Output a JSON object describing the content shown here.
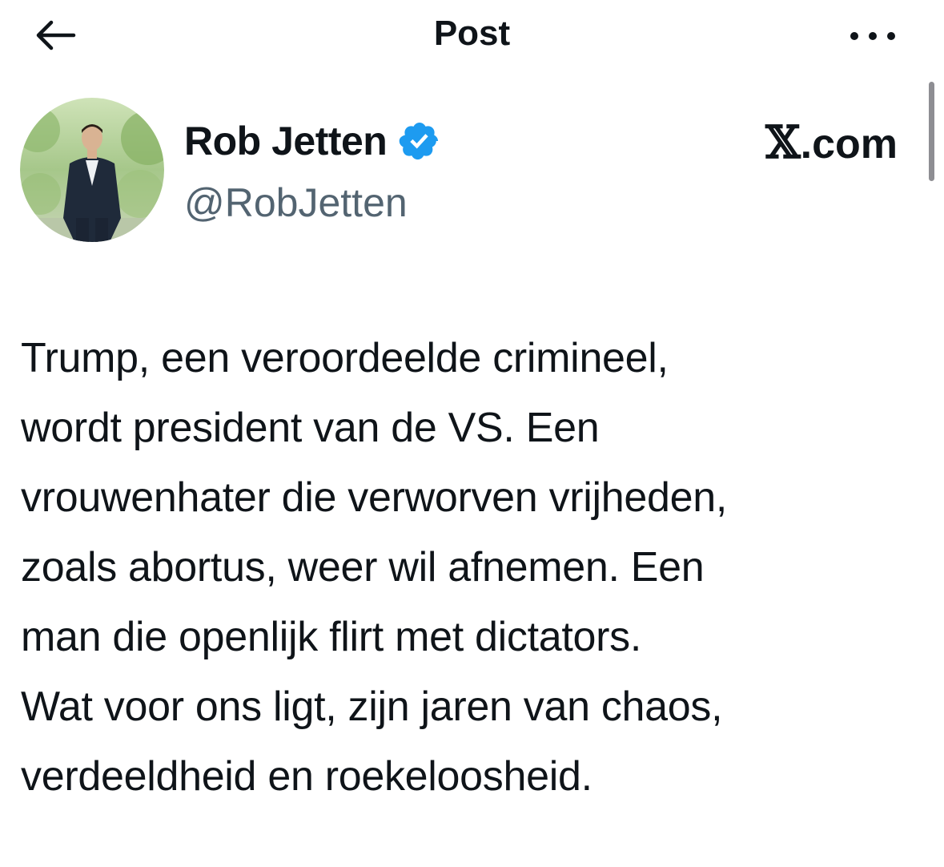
{
  "header": {
    "title": "Post",
    "back_icon": "arrow-left-icon",
    "more_icon": "more-horizontal-icon"
  },
  "author": {
    "name": "Rob Jetten",
    "handle": "@RobJetten",
    "verified_icon": "verified-badge-icon",
    "verified_color": "#1d9bf0"
  },
  "brand": {
    "logo": "𝕏",
    "text": ".com"
  },
  "post": {
    "lines": [
      "Trump, een veroordeelde crimineel,",
      "wordt president van de VS. Een",
      "vrouwenhater die verworven vrijheden,",
      "zoals abortus, weer wil afnemen. Een",
      "man die openlijk flirt met dictators.",
      "Wat voor ons ligt, zijn jaren van chaos,",
      "verdeeldheid en roekeloosheid."
    ]
  },
  "colors": {
    "text": "#0f1419",
    "secondary": "#536471",
    "background": "#ffffff",
    "accent": "#1d9bf0"
  }
}
